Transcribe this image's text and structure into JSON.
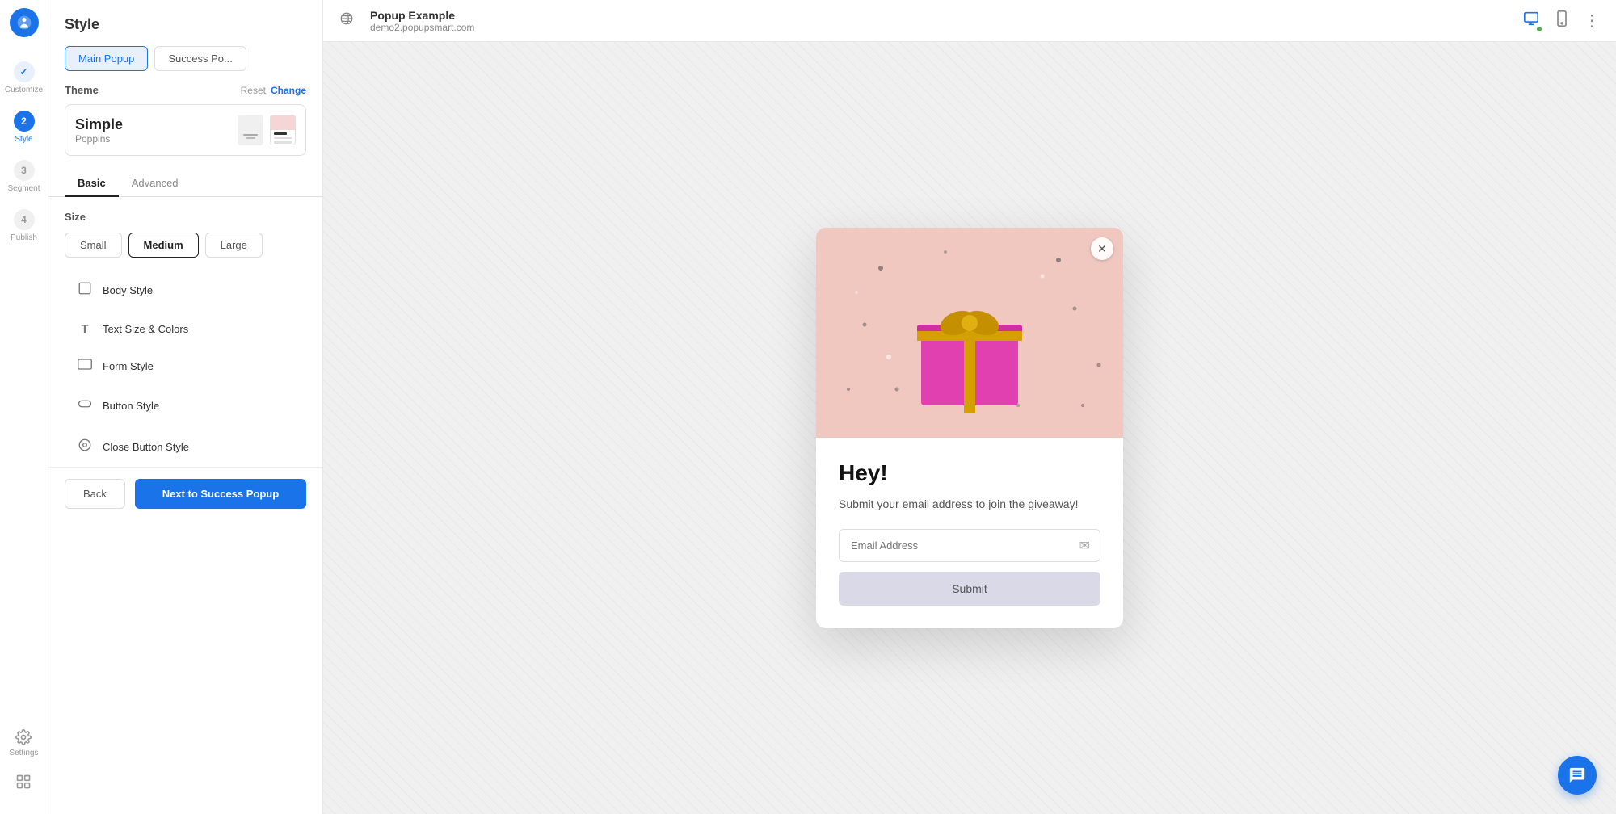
{
  "app": {
    "title": "Popup Example",
    "url": "demo2.popupsmart.com"
  },
  "rail": {
    "steps": [
      {
        "id": "customize",
        "number": "✓",
        "label": "Customize",
        "state": "done"
      },
      {
        "id": "style",
        "number": "2",
        "label": "Style",
        "state": "active"
      },
      {
        "id": "segment",
        "number": "3",
        "label": "Segment",
        "state": "inactive"
      },
      {
        "id": "publish",
        "number": "4",
        "label": "Publish",
        "state": "inactive"
      }
    ]
  },
  "panel": {
    "title": "Style",
    "popup_type_buttons": [
      {
        "id": "main",
        "label": "Main Popup",
        "active": true
      },
      {
        "id": "success",
        "label": "Success Po...",
        "active": false
      }
    ],
    "theme": {
      "label": "Theme",
      "reset_label": "Reset",
      "change_label": "Change",
      "name": "Simple",
      "font": "Poppins"
    },
    "tabs": [
      {
        "id": "basic",
        "label": "Basic",
        "active": true
      },
      {
        "id": "advanced",
        "label": "Advanced",
        "active": false
      }
    ],
    "size": {
      "label": "Size",
      "options": [
        {
          "id": "small",
          "label": "Small",
          "active": false
        },
        {
          "id": "medium",
          "label": "Medium",
          "active": true
        },
        {
          "id": "large",
          "label": "Large",
          "active": false
        }
      ]
    },
    "style_options": [
      {
        "id": "body-style",
        "icon": "☐",
        "label": "Body Style"
      },
      {
        "id": "text-size-colors",
        "icon": "T",
        "label": "Text Size & Colors"
      },
      {
        "id": "form-style",
        "icon": "▭",
        "label": "Form Style"
      },
      {
        "id": "button-style",
        "icon": "◉",
        "label": "Button Style"
      },
      {
        "id": "close-button-style",
        "icon": "⊙",
        "label": "Close Button Style"
      }
    ],
    "footer": {
      "back_label": "Back",
      "next_label": "Next to Success Popup"
    }
  },
  "popup_preview": {
    "headline": "Hey!",
    "subtext": "Submit your email address to join the giveaway!",
    "email_placeholder": "Email Address",
    "submit_label": "Submit"
  },
  "topbar": {
    "device_icons": [
      "desktop",
      "mobile"
    ],
    "more_label": "⋮"
  }
}
